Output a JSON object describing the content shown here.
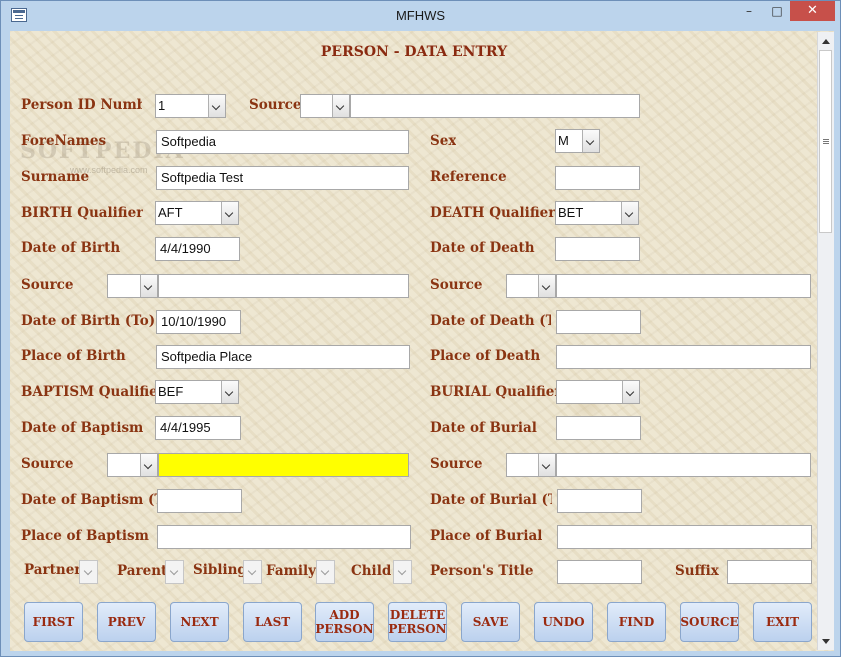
{
  "window": {
    "title": "MFHWS",
    "minimize": "–",
    "maximize": "□",
    "close": "✕"
  },
  "form": {
    "title": "PERSON - DATA ENTRY",
    "watermark": "SOFTPEDIA",
    "watermark_sub": "www.softpedia.com",
    "labels": {
      "person_id": "Person ID Number",
      "source_top": "Source",
      "forenames": "ForeNames",
      "sex": "Sex",
      "surname": "Surname",
      "reference": "Reference",
      "birth_qualifier": "BIRTH Qualifier",
      "death_qualifier": "DEATH Qualifier",
      "date_of_birth": "Date of Birth",
      "date_of_death": "Date of Death",
      "source_birth": "Source",
      "source_death": "Source",
      "date_of_birth_to": "Date of Birth (To)",
      "date_of_death_to": "Date of Death (To)",
      "place_of_birth": "Place of Birth",
      "place_of_death": "Place of Death",
      "baptism_qualifier": "BAPTISM Qualifier",
      "burial_qualifier": "BURIAL Qualifier",
      "date_of_baptism": "Date of Baptism",
      "date_of_burial": "Date of Burial",
      "source_baptism": "Source",
      "source_burial": "Source",
      "date_of_baptism_to": "Date of Baptism (To)",
      "date_of_burial_to": "Date of Burial (To)",
      "place_of_baptism": "Place of Baptism",
      "place_of_burial": "Place of Burial",
      "partner": "Partner",
      "parent": "Parent",
      "sibling": "Sibling",
      "family": "Family",
      "child": "Child",
      "persons_title": "Person's Title",
      "suffix": "Suffix"
    },
    "values": {
      "person_id": "1",
      "forenames": "Softpedia",
      "sex": "M",
      "surname": "Softpedia Test",
      "birth_qualifier": "AFT",
      "death_qualifier": "BET",
      "date_of_birth": "4/4/1990",
      "date_of_birth_to": "10/10/1990",
      "place_of_birth": "Softpedia Place",
      "baptism_qualifier": "BEF",
      "date_of_baptism": "4/4/1995"
    },
    "highlight_color": "#ffff00"
  },
  "buttons": {
    "first": "FIRST",
    "prev": "PREV",
    "next": "NEXT",
    "last": "LAST",
    "add_person": "ADD PERSON",
    "delete_person": "DELETE PERSON",
    "save": "SAVE",
    "undo": "UNDO",
    "find": "FIND",
    "source": "SOURCE",
    "exit": "EXIT"
  }
}
